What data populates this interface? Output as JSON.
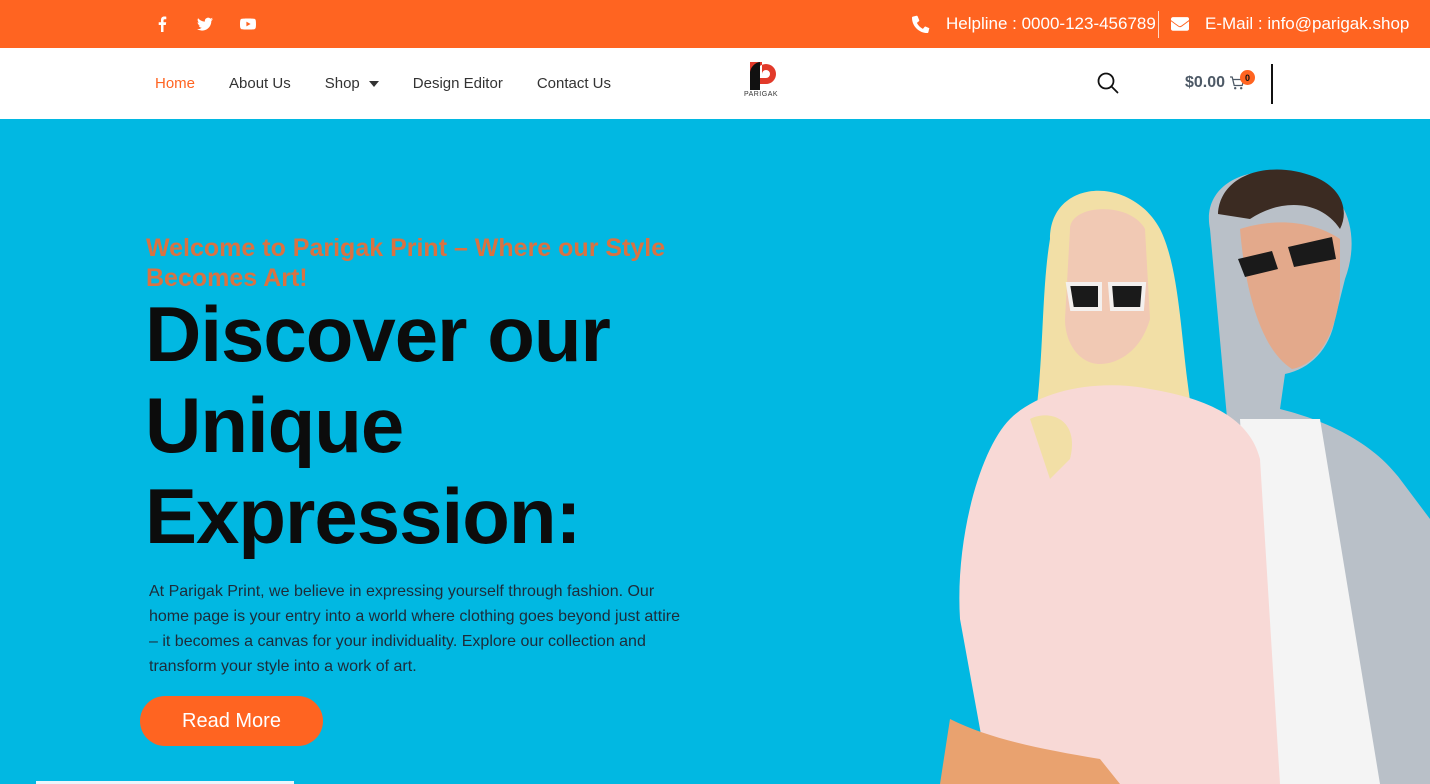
{
  "topbar": {
    "social": [
      "facebook-icon",
      "twitter-icon",
      "youtube-icon"
    ],
    "helpline": "Helpline : 0000-123-456789",
    "email": "E-Mail : info@parigak.shop"
  },
  "nav": {
    "items": [
      {
        "label": "Home",
        "active": true
      },
      {
        "label": "About Us"
      },
      {
        "label": "Shop",
        "dropdown": true
      },
      {
        "label": "Design Editor"
      },
      {
        "label": "Contact Us"
      }
    ]
  },
  "logo": {
    "text": "PARIGAK"
  },
  "cart": {
    "amount": "$0.00",
    "count": "0"
  },
  "hero": {
    "subtitle": "Welcome to Parigak Print – Where our Style Becomes Art!",
    "headline": "Discover our Unique Expression:",
    "description": "At Parigak Print, we believe in expressing yourself through fashion. Our home page is your entry into a world where clothing goes beyond just attire – it becomes a canvas for your individuality. Explore our collection and transform your style into a work of art.",
    "button": "Read More"
  },
  "colors": {
    "accent": "#ff6421",
    "hero_bg": "#01b8e2",
    "subtitle": "#d97242"
  }
}
